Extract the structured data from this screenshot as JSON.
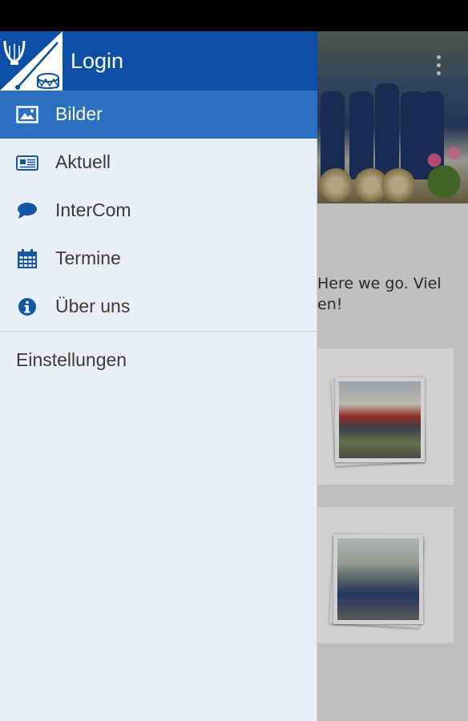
{
  "drawer": {
    "header": {
      "title": "Login",
      "logo_icon": "lyre-and-drum-logo"
    },
    "items": [
      {
        "label": "Bilder",
        "icon": "image-icon",
        "active": true
      },
      {
        "label": "Aktuell",
        "icon": "newspaper-icon",
        "active": false
      },
      {
        "label": "InterCom",
        "icon": "chat-bubble-icon",
        "active": false
      },
      {
        "label": "Termine",
        "icon": "calendar-icon",
        "active": false
      },
      {
        "label": "Über uns",
        "icon": "info-icon",
        "active": false
      }
    ],
    "settings_label": "Einstellungen"
  },
  "background": {
    "message_text": "Here we go. Viel\nen!"
  },
  "colors": {
    "header_bg": "#0d4ea6",
    "active_item_bg": "#2a6fc0",
    "drawer_bg": "#e9eff7",
    "icon_blue": "#1655a6"
  }
}
